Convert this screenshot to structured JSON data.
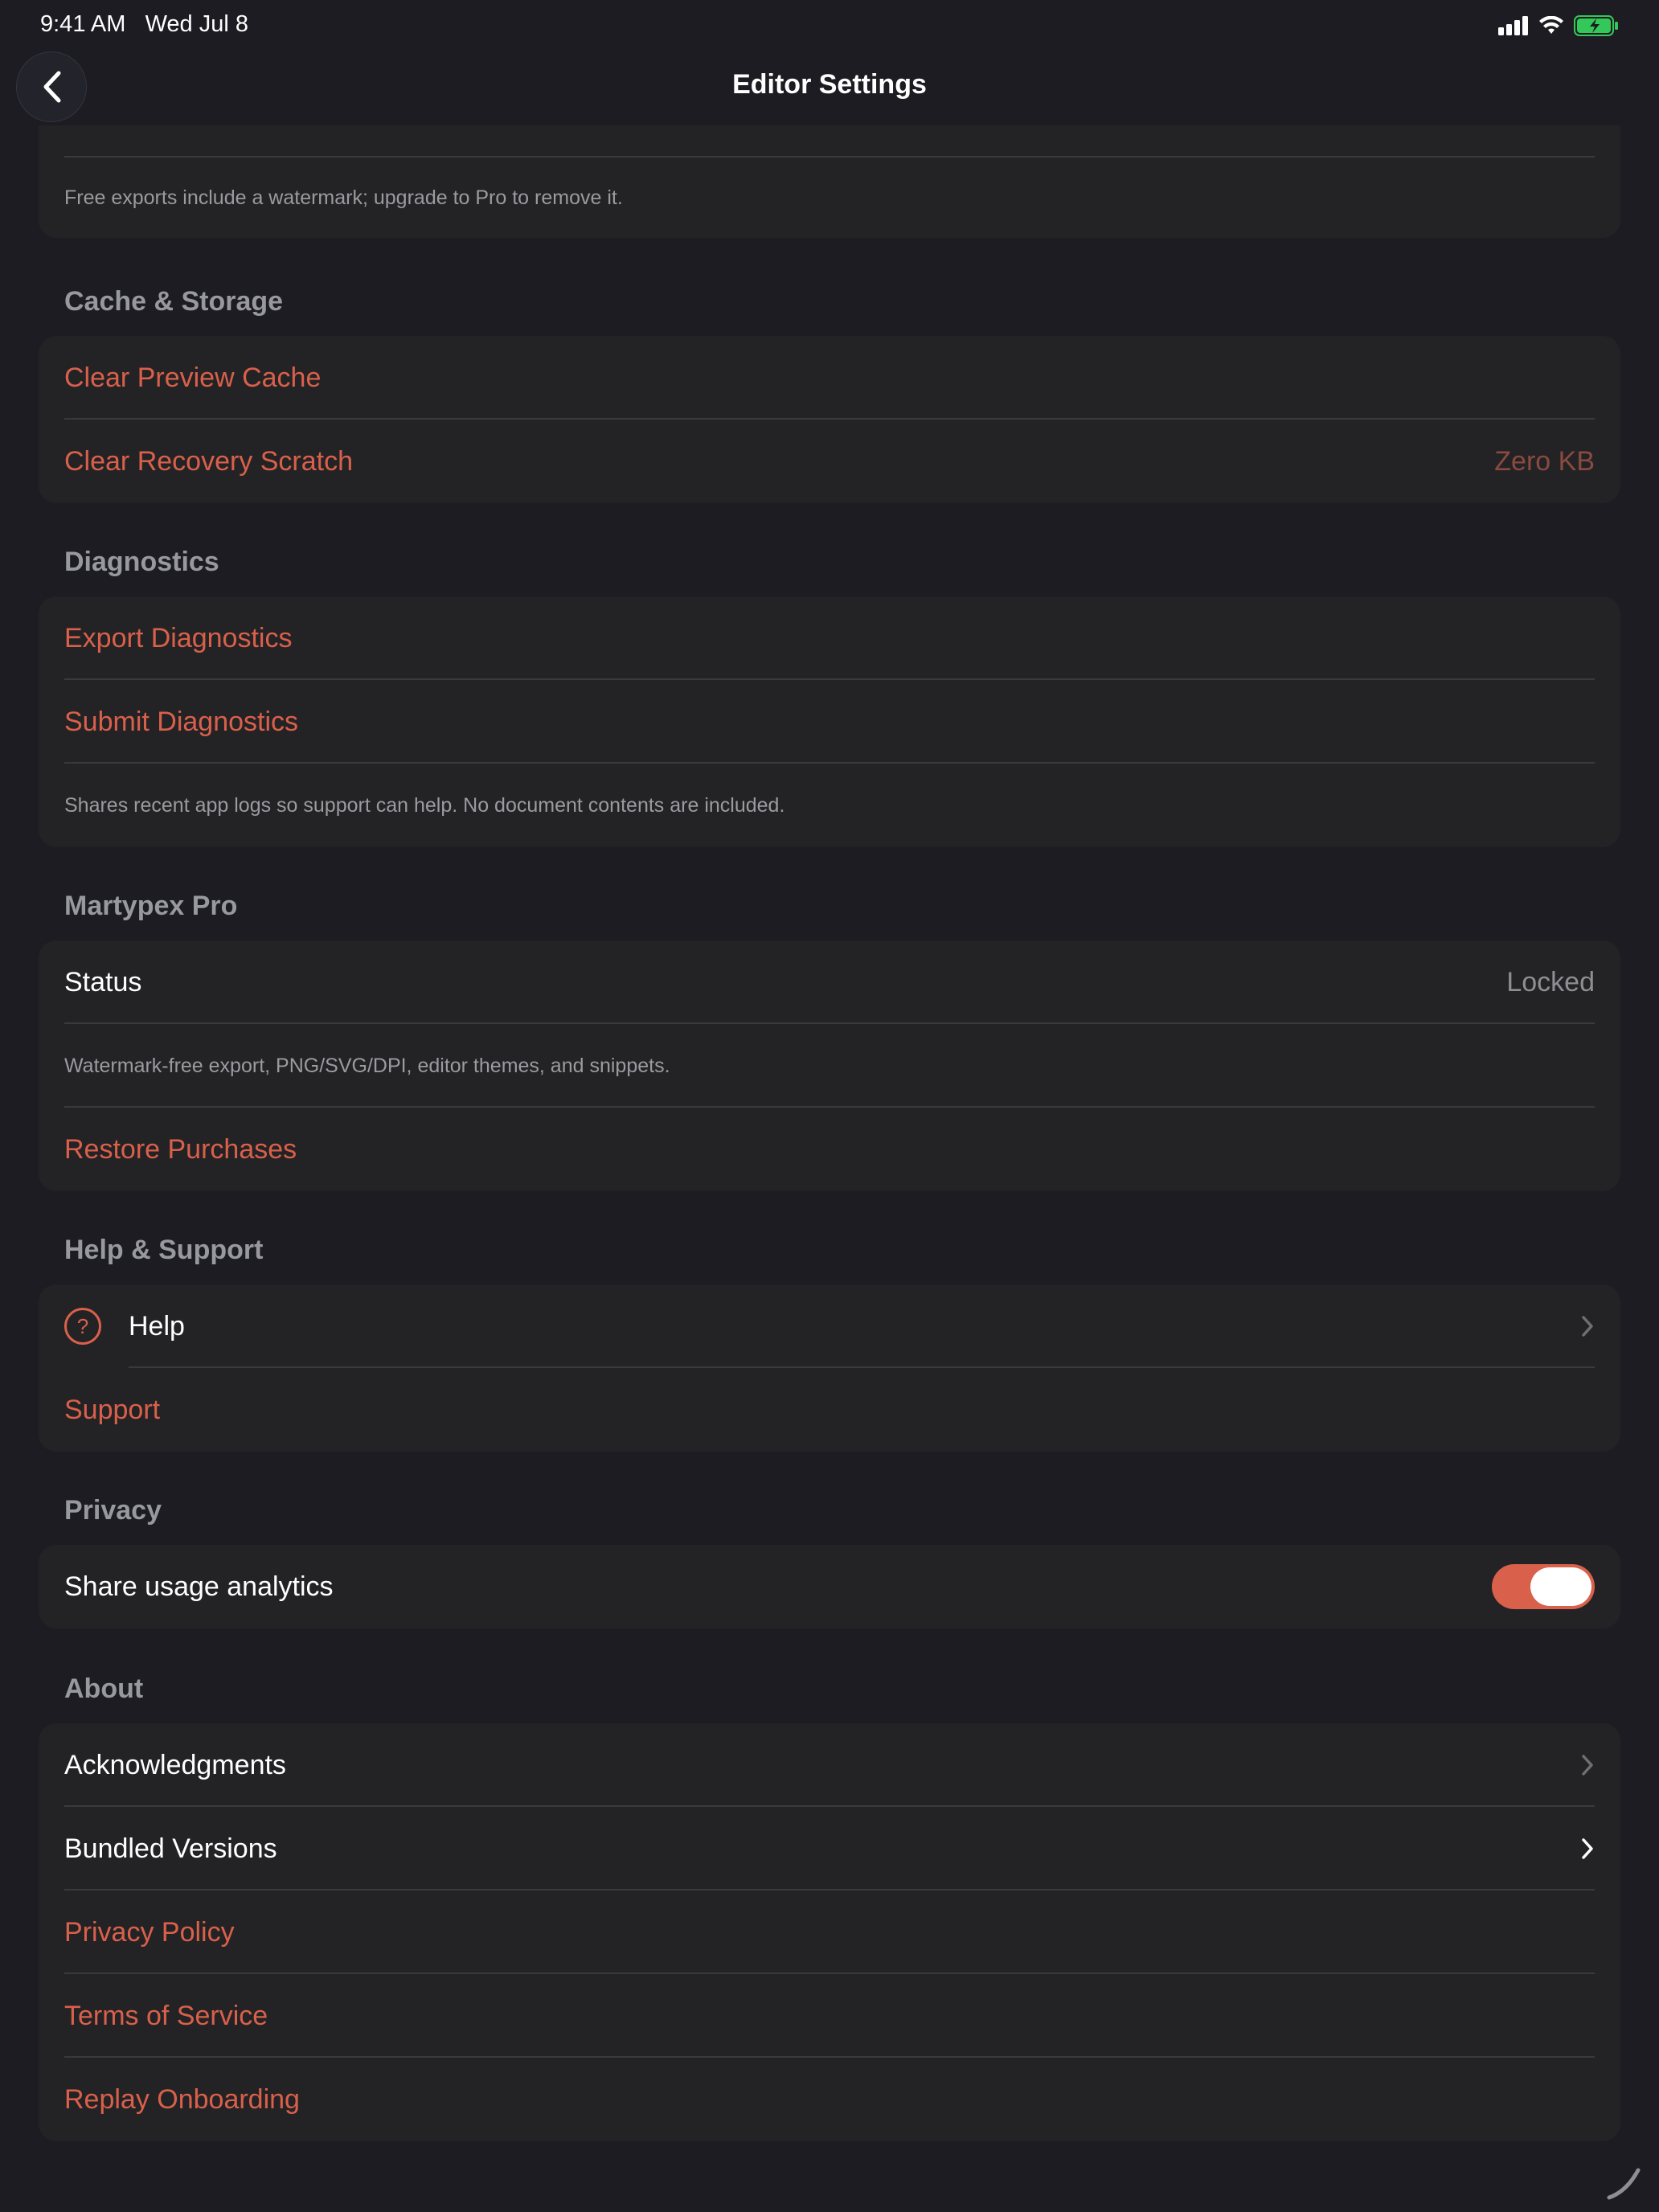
{
  "status_bar": {
    "time": "9:41 AM",
    "date": "Wed Jul 8",
    "battery_color": "#34c759"
  },
  "nav": {
    "title": "Editor Settings",
    "back_icon": "chevron-left-icon"
  },
  "colors": {
    "accent": "#d9604a",
    "background": "#1c1c22",
    "card": "#232326"
  },
  "export_note": "Free exports include a watermark; upgrade to Pro to remove it.",
  "cache": {
    "header": "Cache & Storage",
    "clear_preview": "Clear Preview Cache",
    "clear_recovery": "Clear Recovery Scratch",
    "recovery_size": "Zero KB"
  },
  "diagnostics": {
    "header": "Diagnostics",
    "export": "Export Diagnostics",
    "submit": "Submit Diagnostics",
    "note": "Shares recent app logs so support can help. No document contents are included."
  },
  "pro": {
    "header": "Martypex Pro",
    "status_label": "Status",
    "status_value": "Locked",
    "note": "Watermark-free export, PNG/SVG/DPI, editor themes, and snippets.",
    "restore": "Restore Purchases"
  },
  "help": {
    "header": "Help & Support",
    "help_label": "Help",
    "help_icon": "question-circle-icon",
    "support": "Support"
  },
  "privacy": {
    "header": "Privacy",
    "analytics_label": "Share usage analytics",
    "analytics_on": true
  },
  "about": {
    "header": "About",
    "acknowledgments": "Acknowledgments",
    "bundled_versions": "Bundled Versions",
    "privacy_policy": "Privacy Policy",
    "terms": "Terms of Service",
    "replay_onboarding": "Replay Onboarding"
  }
}
